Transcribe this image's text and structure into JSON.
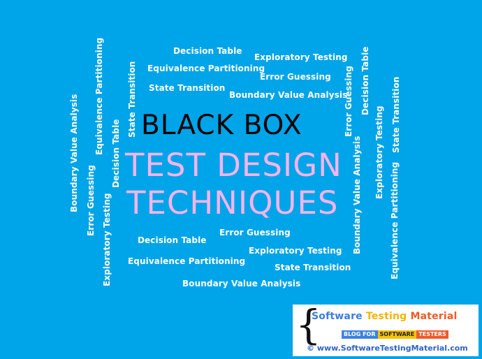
{
  "background_color": "#00a4e8",
  "headline": {
    "line1": "BLACK BOX",
    "line2": "TEST DESIGN",
    "line3": "TECHNIQUES",
    "line1_color": "#000000",
    "line2_color": "#f7b3ea"
  },
  "words": {
    "top": [
      "Decision Table",
      "Exploratory Testing",
      "Equivalence Partitioning",
      "Error Guessing",
      "State Transition",
      "Boundary Value Analysis"
    ],
    "bottom": [
      "Error Guessing",
      "Decision Table",
      "Exploratory Testing",
      "Equivalence Partitioning",
      "State Transition",
      "Boundary Value Analysis"
    ],
    "left_vertical": [
      "Boundary Value Analysis",
      "Error Guessing",
      "Equivalence Partitioning",
      "Exploratory Testing",
      "Decision Table",
      "State Transition"
    ],
    "right_vertical": [
      "Error Guessing",
      "Decision Table",
      "Boundary Value Analysis",
      "Exploratory Testing",
      "State Transition",
      "Equivalence Partitioning"
    ]
  },
  "logo": {
    "brace": "{",
    "brand_part1": "Software ",
    "brand_part2": "Testing ",
    "brand_part3": "Material",
    "tagline_part1": "BLOG FOR",
    "tagline_part2": "SOFTWARE",
    "tagline_part3": "TESTERS",
    "url": "© www.SoftwareTestingMaterial.com",
    "colors": {
      "blue": "#3b7ddd",
      "yellow": "#f3b400",
      "orange": "#f05a28"
    }
  }
}
